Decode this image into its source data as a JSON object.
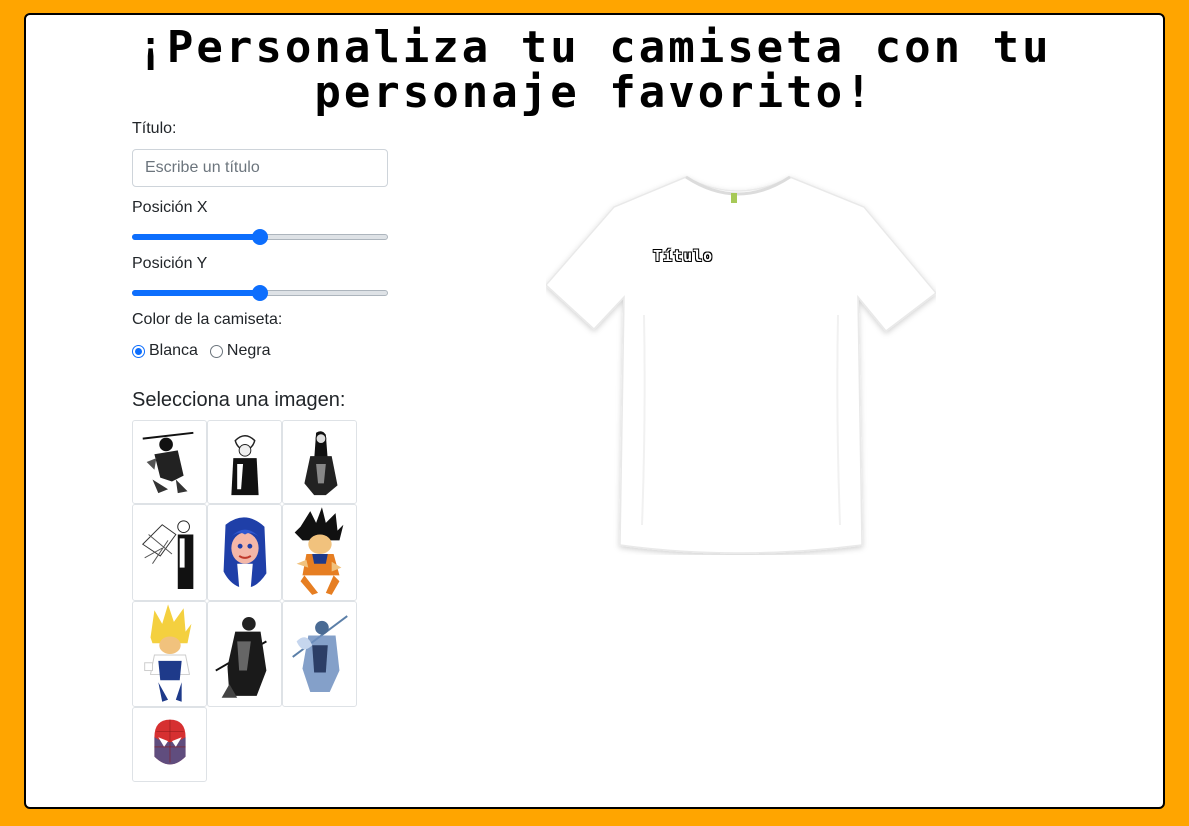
{
  "header": {
    "title": "¡Personaliza tu camiseta con tu personaje favorito!"
  },
  "form": {
    "title_label": "Título:",
    "title_placeholder": "Escribe un título",
    "title_value": "",
    "pos_x_label": "Posición X",
    "pos_x_value": 0.5,
    "pos_y_label": "Posición Y",
    "pos_y_value": 0.5,
    "color_label": "Color de la camiseta:",
    "colors": [
      {
        "label": "Blanca",
        "selected": true
      },
      {
        "label": "Negra",
        "selected": false
      }
    ]
  },
  "gallery": {
    "title": "Selecciona una imagen:",
    "images": [
      "manga-swordsman-icon",
      "manga-white-hair-character-icon",
      "manga-long-hair-character-icon",
      "manga-sketch-character-icon",
      "blue-hair-girl-icon",
      "goku-icon",
      "vegeta-icon",
      "dark-knight-icon",
      "blue-armored-knight-icon",
      "spiderman-mask-icon"
    ]
  },
  "preview": {
    "shirt_text": "Título",
    "shirt_color": "#ffffff"
  },
  "colors": {
    "background": "#FFA500",
    "accent": "#0d6efd"
  }
}
